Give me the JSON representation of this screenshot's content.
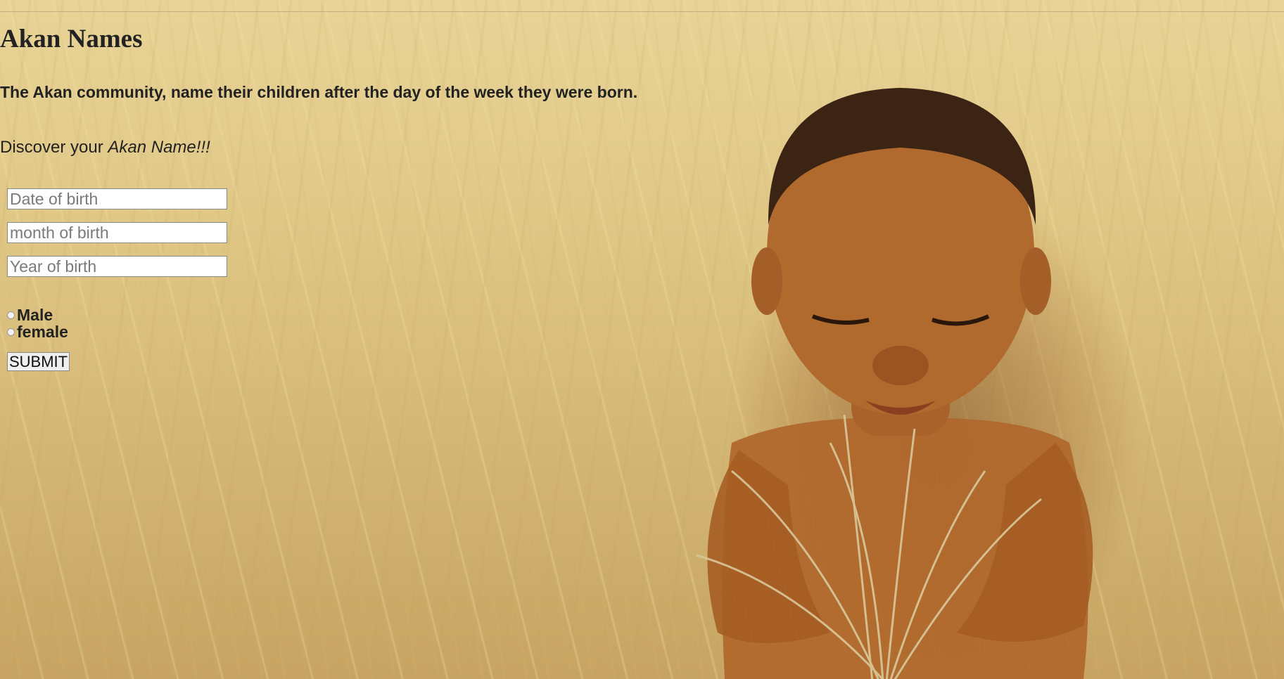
{
  "page": {
    "title": "Akan Names",
    "subtitle": "The Akan community, name their children after the day of the week they were born.",
    "discover_prefix": "Discover your ",
    "discover_emphasis": "Akan Name!!!"
  },
  "form": {
    "date_placeholder": "Date of birth",
    "month_placeholder": "month of birth",
    "year_placeholder": "Year of birth",
    "gender_options": [
      "Male",
      "female"
    ],
    "submit_label": "SUBMIT"
  },
  "colors": {
    "background": "#dfc685",
    "text": "#222222"
  }
}
